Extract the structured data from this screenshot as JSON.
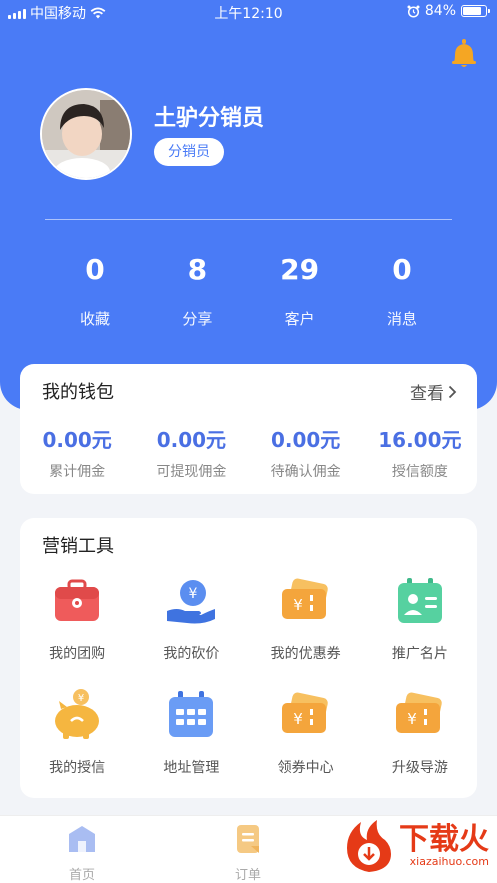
{
  "status_bar": {
    "carrier": "中国移动",
    "time": "上午12:10",
    "battery": "84%",
    "battery_level": 0.84
  },
  "profile": {
    "name": "土驴分销员",
    "role": "分销员"
  },
  "stats": [
    {
      "value": "0",
      "label": "收藏"
    },
    {
      "value": "8",
      "label": "分享"
    },
    {
      "value": "29",
      "label": "客户"
    },
    {
      "value": "0",
      "label": "消息"
    }
  ],
  "wallet": {
    "title": "我的钱包",
    "more": "查看",
    "items": [
      {
        "amount": "0.00元",
        "label": "累计佣金"
      },
      {
        "amount": "0.00元",
        "label": "可提现佣金"
      },
      {
        "amount": "0.00元",
        "label": "待确认佣金"
      },
      {
        "amount": "16.00元",
        "label": "授信额度"
      }
    ]
  },
  "tools": {
    "title": "营销工具",
    "items": [
      {
        "label": "我的团购",
        "icon": "group-buy-icon"
      },
      {
        "label": "我的砍价",
        "icon": "bargain-icon"
      },
      {
        "label": "我的优惠券",
        "icon": "coupon-icon"
      },
      {
        "label": "推广名片",
        "icon": "business-card-icon"
      },
      {
        "label": "我的授信",
        "icon": "piggy-bank-icon"
      },
      {
        "label": "地址管理",
        "icon": "calendar-icon"
      },
      {
        "label": "领券中心",
        "icon": "coupon-center-icon"
      },
      {
        "label": "升级导游",
        "icon": "upgrade-guide-icon"
      }
    ]
  },
  "tabs": [
    {
      "label": "首页",
      "icon": "home-icon"
    },
    {
      "label": "订单",
      "icon": "order-icon"
    }
  ],
  "watermark": {
    "text": "下载火",
    "sub": "xiazaihuo.com"
  },
  "colors": {
    "primary": "#4a7bf6",
    "amount": "#4a6fe3",
    "watermark": "#e53a17"
  }
}
